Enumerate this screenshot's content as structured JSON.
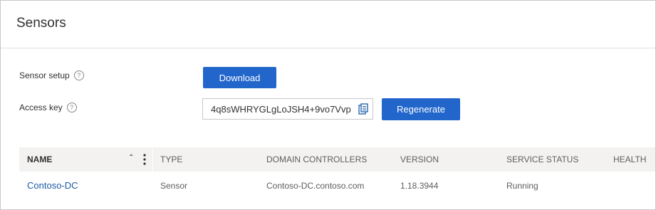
{
  "page": {
    "title": "Sensors"
  },
  "setup": {
    "sensor_setup_label": "Sensor setup",
    "download_label": "Download",
    "access_key_label": "Access key",
    "access_key_value": "4q8sWHRYGLgLoJSH4+9vo7Vvp",
    "regenerate_label": "Regenerate"
  },
  "table": {
    "columns": [
      "NAME",
      "TYPE",
      "DOMAIN CONTROLLERS",
      "VERSION",
      "SERVICE STATUS",
      "HEALTH"
    ],
    "rows": [
      {
        "name": "Contoso-DC",
        "type": "Sensor",
        "domain_controllers": "Contoso-DC.contoso.com",
        "version": "1.18.3944",
        "service_status": "Running",
        "health": ""
      }
    ]
  },
  "icons": {
    "help": "help-circle-icon",
    "copy": "copy-icon",
    "sort": "sort-ascending-icon",
    "more": "more-vertical-icon"
  },
  "colors": {
    "primary_button": "#2266cc",
    "link": "#1b5ba6",
    "table_header_bg": "#f3f2f1"
  }
}
